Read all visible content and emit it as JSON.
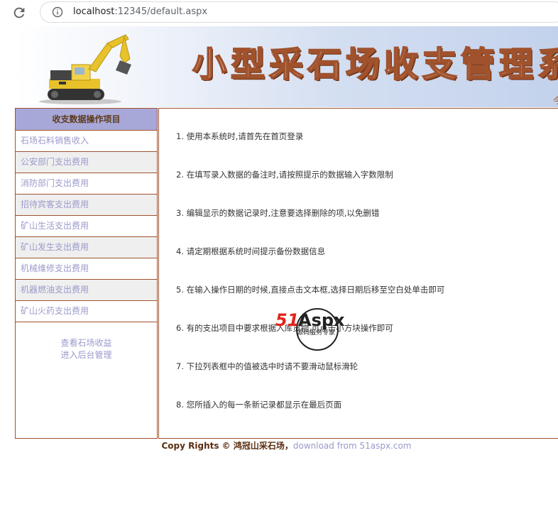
{
  "browser": {
    "url_host": "localhost",
    "url_rest": ":12345/default.aspx"
  },
  "banner": {
    "title": "小型采石场收支管理系统",
    "edge_char": "今"
  },
  "sidebar": {
    "heading": "收支数据操作项目",
    "items": [
      {
        "label": "石场石料销售收入"
      },
      {
        "label": "公安部门支出费用"
      },
      {
        "label": "消防部门支出费用"
      },
      {
        "label": "招待宾客支出费用"
      },
      {
        "label": "矿山生活支出费用"
      },
      {
        "label": "矿山发生支出费用"
      },
      {
        "label": "机械维修支出费用"
      },
      {
        "label": "机器燃油支出费用"
      },
      {
        "label": "矿山火药支出费用"
      }
    ],
    "link_income": "查看石场收益",
    "link_admin": "进入后台管理"
  },
  "notes": [
    "1. 使用本系统时,请首先在首页登录",
    "2. 在填写录入数据的备注时,请按照提示的数据输入字数限制",
    "3. 编辑显示的数据记录时,注意要选择删除的项,以免删错",
    "4. 请定期根据系统时间提示备份数据信息",
    "5. 在输入操作日期的时候,直接点击文本框,选择日期后移至空白处单击即可",
    "6. 有的支出项目中要求根据入库货物,可点击小方块操作即可",
    "7. 下拉列表框中的值被选中时请不要滑动鼠标滑轮",
    "8. 您所插入的每一条新记录都显示在最后页面"
  ],
  "footer": {
    "copyright": "Copy Rights © 鸿冠山采石场，",
    "download": "download from 51aspx.com"
  },
  "watermark": {
    "logo_51": "51",
    "logo_aspx": "Aspx",
    "tagline": "源码服务专家"
  },
  "colors": {
    "border_brown": "#a0522d",
    "menu_text": "#9a9acc",
    "sidebar_header_bg": "#a8a8d8"
  }
}
